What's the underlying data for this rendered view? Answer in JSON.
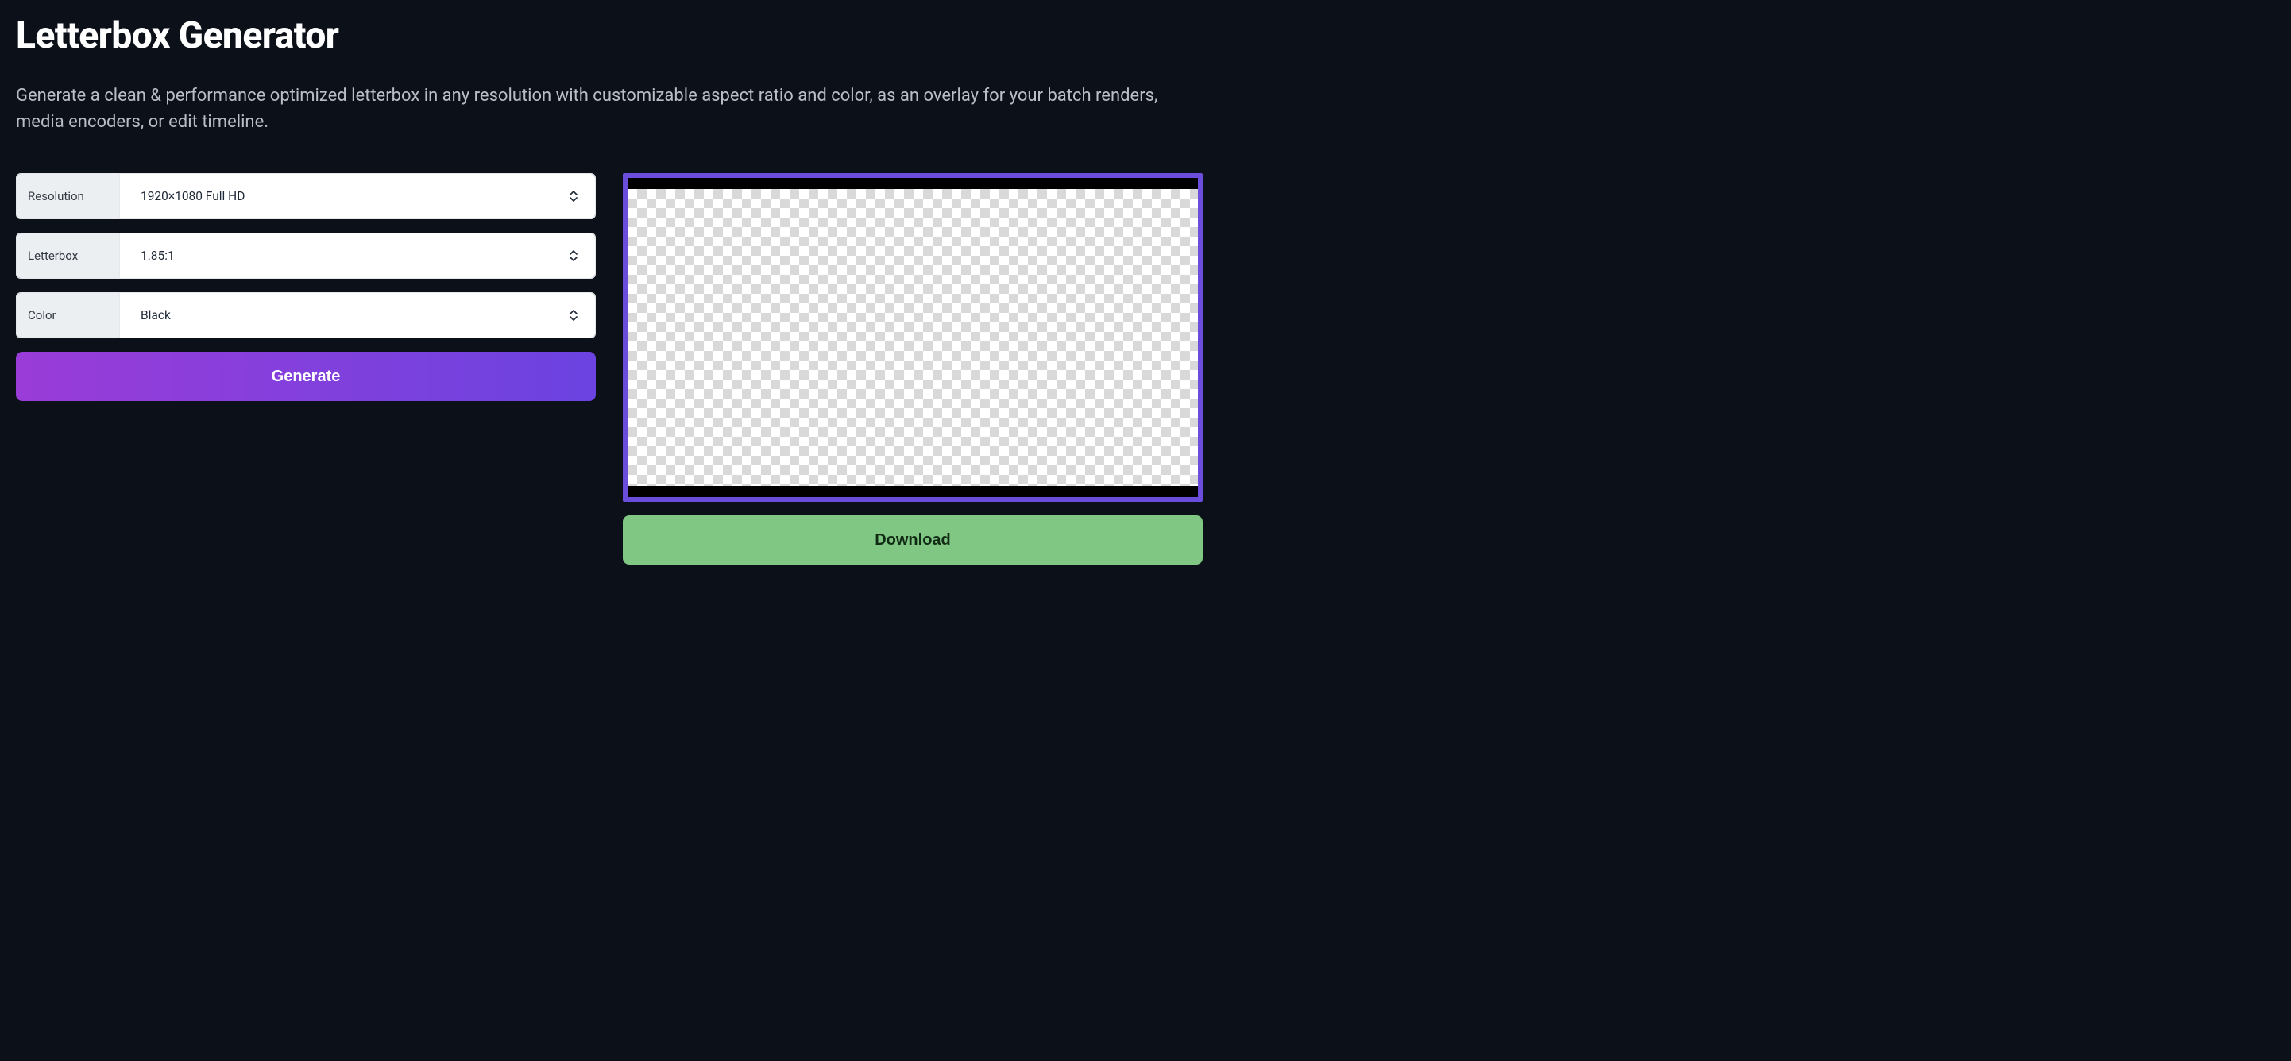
{
  "header": {
    "title": "Letterbox Generator",
    "description": "Generate a clean & performance optimized letterbox in any resolution with customizable aspect ratio and color, as an overlay for your batch renders, media encoders, or edit timeline."
  },
  "form": {
    "resolution": {
      "label": "Resolution",
      "value": "1920×1080 Full HD"
    },
    "letterbox": {
      "label": "Letterbox",
      "value": "1.85:1"
    },
    "color": {
      "label": "Color",
      "value": "Black"
    },
    "generate_label": "Generate"
  },
  "preview": {
    "frame_accent": "#6b4ddb",
    "bar_color": "#000000"
  },
  "actions": {
    "download_label": "Download"
  },
  "icons": {
    "up_down": "up-down-icon"
  }
}
